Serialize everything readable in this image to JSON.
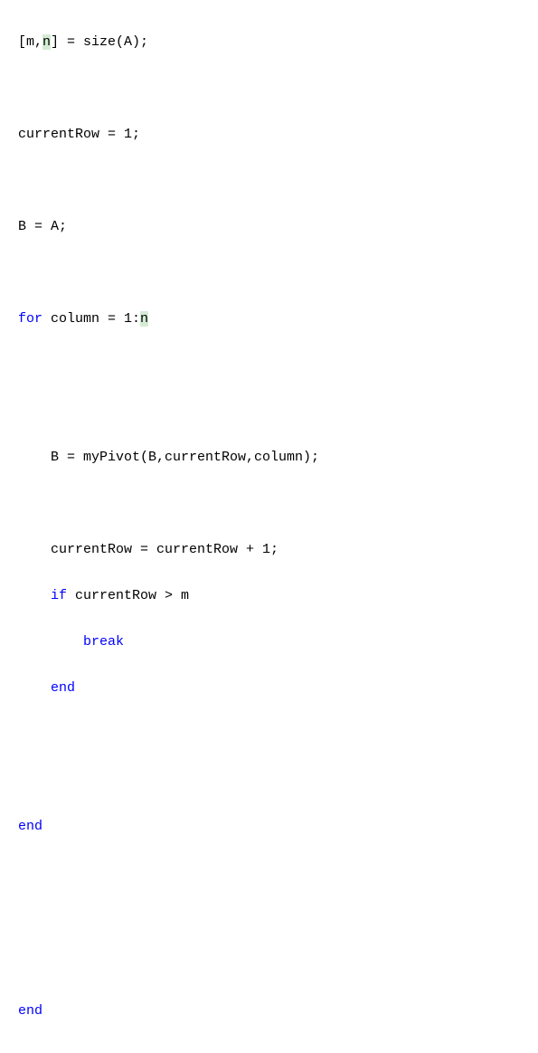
{
  "code": {
    "line1": {
      "t1": "[m,",
      "t2_hl": "n",
      "t3": "] = size(A);"
    },
    "line3": "currentRow = 1;",
    "line5": "B = A;",
    "line7": {
      "kw_for": "for",
      "t1": " column = 1:",
      "t2_hl": "n"
    },
    "line10": "B = myPivot(B,currentRow,column);",
    "line12": "currentRow = currentRow + 1;",
    "line13": {
      "kw_if": "if",
      "t1": " currentRow > m"
    },
    "line14": {
      "kw_break": "break"
    },
    "line15": {
      "kw_end": "end"
    },
    "line18": {
      "kw_end": "end"
    },
    "line22": {
      "kw_end": "end"
    }
  }
}
